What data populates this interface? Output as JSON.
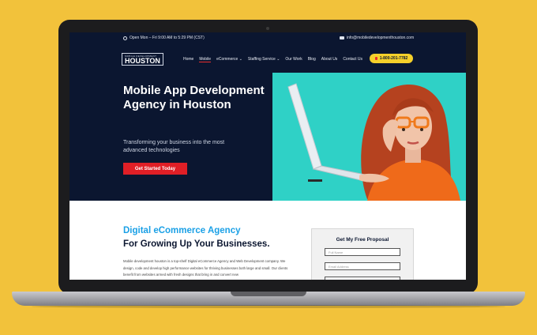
{
  "topbar": {
    "hours": "Open Mon – Fri 9:00 AM to 5:29 PM (CST)",
    "email": "info@mobiledevelopmenthouston.com"
  },
  "logo": {
    "top": "MOBILE DEVELOPMENT",
    "main": "HOUSTON"
  },
  "nav": {
    "items": [
      "Home",
      "Mobile",
      "eCommerce ⌄",
      "Staffing Service ⌄",
      "Our Work",
      "Blog",
      "About Us",
      "Contact Us"
    ],
    "phone": "1-800-201-7782"
  },
  "hero": {
    "title": "Mobile App Development Agency in Houston",
    "subtitle": "Transforming your business into the most advanced technologies",
    "cta": "Get Started Today"
  },
  "section": {
    "title_line1": "Digital eCommerce Agency",
    "title_line2": "For Growing Up Your Businesses.",
    "body": "Mobile development houston is a top-shelf Digital eCommerce Agency and Web Development company. We design, code and develop high performance websites for thriving businesses both large and small. Our clients benefit from websites armed with fresh designs that bring in and convert new"
  },
  "form": {
    "title": "Get My Free Proposal",
    "name_placeholder": "Full Name",
    "email_placeholder": "Email Address",
    "phone_placeholder": ""
  },
  "colors": {
    "navy": "#0b1630",
    "accent_red": "#e01f26",
    "accent_blue": "#1aa0e6",
    "teal": "#2fd1c6",
    "yellow": "#f5d02a"
  }
}
